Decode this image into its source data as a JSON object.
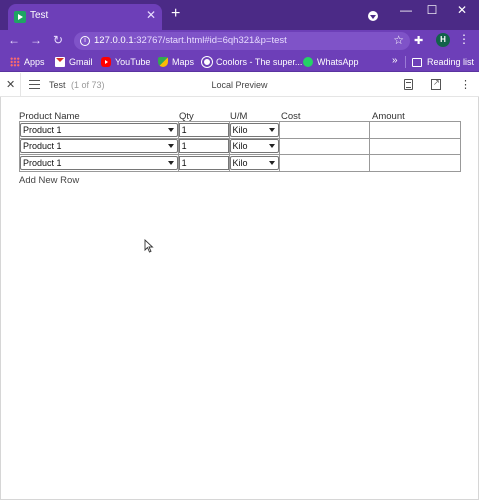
{
  "browser": {
    "tab_title": "Test",
    "tab_close": "✕",
    "new_tab": "+",
    "window_minimize": "—",
    "window_maximize": "☐",
    "window_close": "✕",
    "nav_back": "←",
    "nav_forward": "→",
    "nav_reload": "↻",
    "url_host": "127.0.0.1",
    "url_rest": ":32767/start.html#id=6qh321&p=test",
    "star": "☆",
    "avatar_letter": "H",
    "menu": "⋮",
    "extensions_icon": "✚"
  },
  "bookmarks": {
    "items": [
      {
        "label": "Apps"
      },
      {
        "label": "Gmail"
      },
      {
        "label": "YouTube"
      },
      {
        "label": "Maps"
      },
      {
        "label": "Coolors - The super..."
      },
      {
        "label": "WhatsApp"
      }
    ],
    "more": "»",
    "reading_list": "Reading list"
  },
  "preview": {
    "close": "✕",
    "title": "Test",
    "count": "(1 of 73)",
    "center_label": "Local Preview",
    "menu": "⋮"
  },
  "table": {
    "headers": [
      "Product Name",
      "Qty",
      "U/M",
      "Cost",
      "Amount"
    ],
    "rows": [
      {
        "product": "Product 1",
        "qty": "1",
        "um": "Kilo",
        "cost": "",
        "amount": ""
      },
      {
        "product": "Product 1",
        "qty": "1",
        "um": "Kilo",
        "cost": "",
        "amount": ""
      },
      {
        "product": "Product 1",
        "qty": "1",
        "um": "Kilo",
        "cost": "",
        "amount": ""
      }
    ],
    "add_row_label": "Add New Row"
  },
  "colors": {
    "titlebar": "#4b2a86",
    "toolbar": "#6d3fb8",
    "omnibox": "#7f53c8",
    "avatar": "#12624a"
  }
}
